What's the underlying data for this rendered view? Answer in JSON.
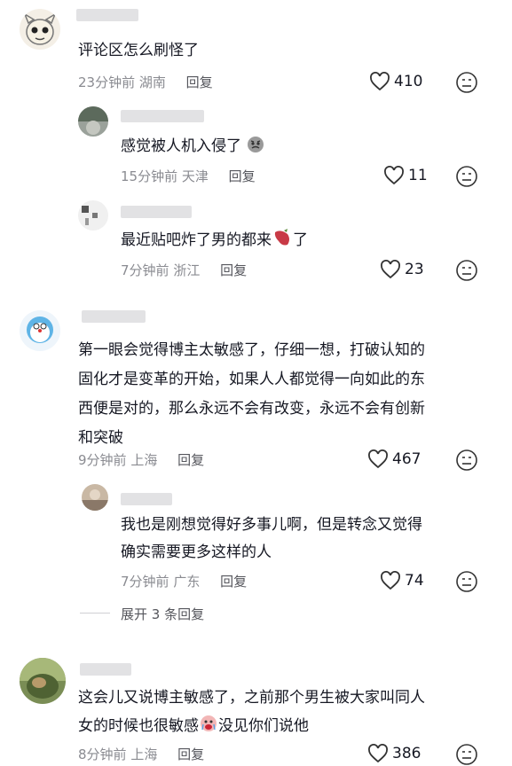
{
  "comments": [
    {
      "text_lines": [
        "评论区怎么刷怪了"
      ],
      "time": "23分钟前",
      "location": "湖南",
      "reply_label": "回复",
      "likes": "410",
      "replies": [
        {
          "text": "感觉被人机入侵了",
          "time": "15分钟前",
          "location": "天津",
          "reply_label": "回复",
          "likes": "11",
          "emoji": "angry-face"
        },
        {
          "text": "最近贴吧炸了男的都来",
          "text_after": "了",
          "time": "7分钟前",
          "location": "浙江",
          "reply_label": "回复",
          "likes": "23",
          "emoji": "sweet-potato"
        }
      ]
    },
    {
      "text_lines": [
        "第一眼会觉得博主太敏感了，仔细一想，打破认知的",
        "固化才是变革的开始，如果人人都觉得一向如此的东",
        "西便是对的，那么永远不会有改变，永远不会有创新",
        "和突破"
      ],
      "time": "9分钟前",
      "location": "上海",
      "reply_label": "回复",
      "likes": "467",
      "replies": [
        {
          "text_lines": [
            "我也是刚想觉得好多事儿啊，但是转念又觉得",
            "确实需要更多这样的人"
          ],
          "time": "7分钟前",
          "location": "广东",
          "reply_label": "回复",
          "likes": "74"
        }
      ],
      "expand_label": "展开 3 条回复"
    },
    {
      "text_lines": [
        "这会儿又说博主敏感了，之前那个男生被大家叫同人",
        "女的时候也很敏感"
      ],
      "text_after": "没见你们说他",
      "emoji": "crying-face",
      "time": "8分钟前",
      "location": "上海",
      "reply_label": "回复",
      "likes": "386"
    }
  ],
  "colors": {
    "text": "#161823",
    "meta": "#8a8b91",
    "reply": "#55565c"
  },
  "icons": [
    "heart-outline-icon",
    "dislike-face-icon"
  ]
}
